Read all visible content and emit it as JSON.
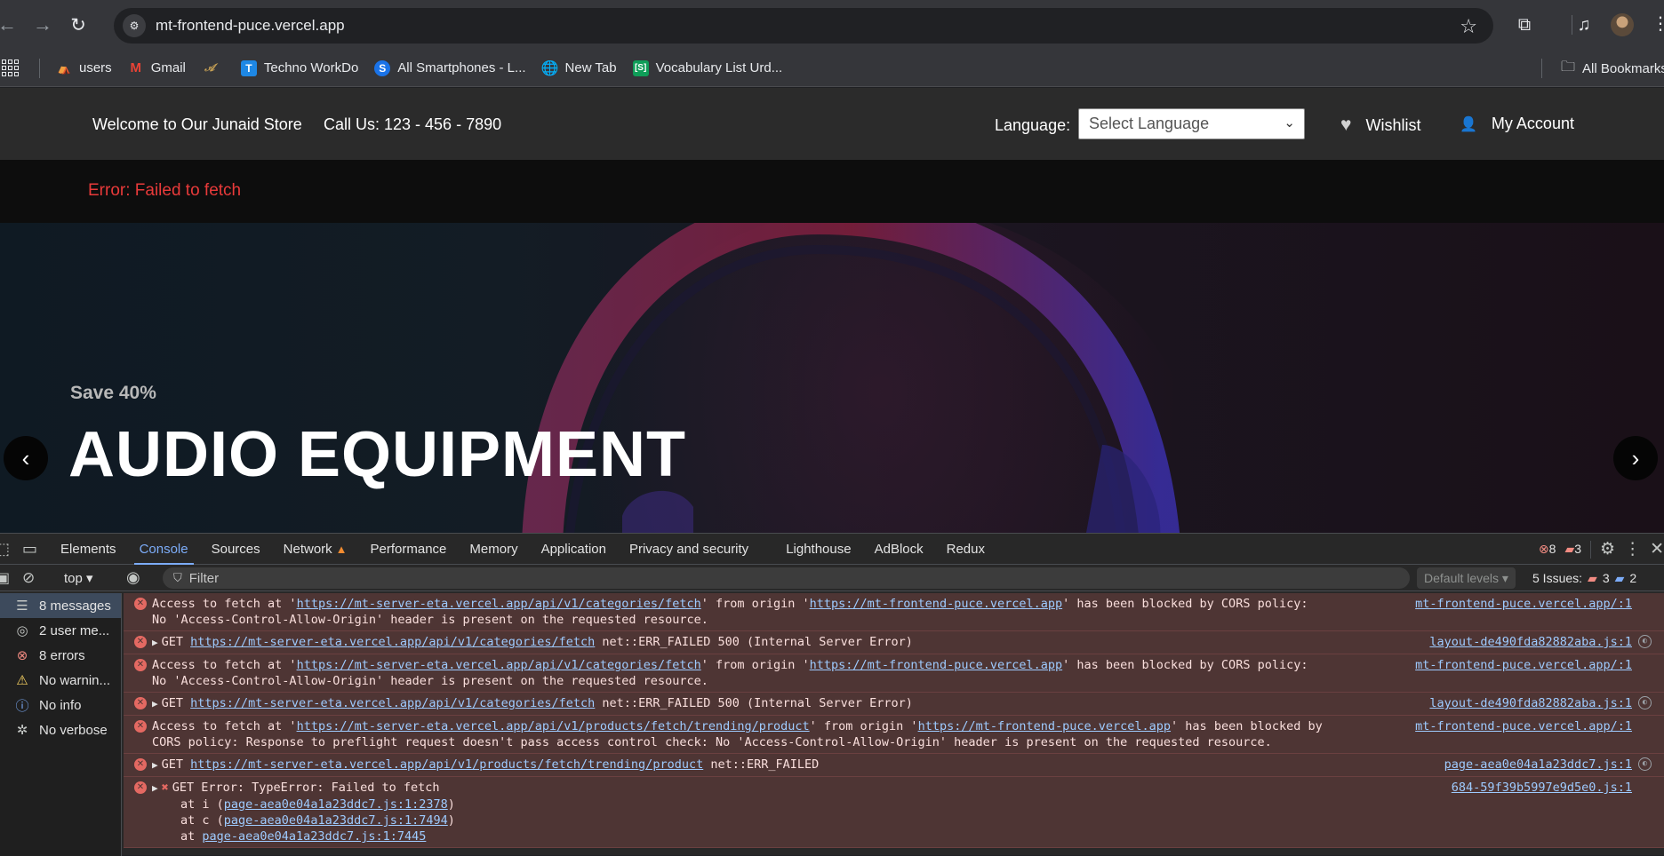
{
  "browser": {
    "url": "mt-frontend-puce.vercel.app",
    "bookmarks": [
      {
        "label": "users",
        "color": "#e6a23c"
      },
      {
        "label": "Gmail",
        "color": "#ea4335"
      },
      {
        "label": "",
        "color": "#c8a255"
      },
      {
        "label": "Techno WorkDo",
        "color": "#1e88e5"
      },
      {
        "label": "All Smartphones - L...",
        "color": "#1a73e8"
      },
      {
        "label": "New Tab",
        "color": "#e8eaed"
      },
      {
        "label": "Vocabulary List Urd...",
        "color": "#0f9d58"
      }
    ],
    "all_bookmarks": "All Bookmarks"
  },
  "page": {
    "welcome": "Welcome to Our Junaid Store",
    "call": "Call Us: 123 - 456 - 7890",
    "language_label": "Language:",
    "language_select": "Select Language",
    "wishlist": "Wishlist",
    "account": "My Account",
    "error": "Error: Failed to fetch",
    "hero": {
      "save": "Save 40%",
      "headline": "AUDIO EQUIPMENT"
    }
  },
  "devtools": {
    "tabs": [
      "Elements",
      "Console",
      "Sources",
      "Network",
      "Performance",
      "Memory",
      "Application",
      "Privacy and security",
      "Lighthouse",
      "AdBlock",
      "Redux"
    ],
    "error_count": "8",
    "issue_count": "3",
    "context": "top",
    "filter_placeholder": "Filter",
    "levels": "Default levels",
    "issues_label": "5 Issues:",
    "issues_err": "3",
    "issues_info": "2",
    "sidebar": [
      {
        "label": "8 messages",
        "icon": "list-icon"
      },
      {
        "label": "2 user me...",
        "icon": "user-icon"
      },
      {
        "label": "8 errors",
        "icon": "error-icon"
      },
      {
        "label": "No warnin...",
        "icon": "warning-icon"
      },
      {
        "label": "No info",
        "icon": "info-icon"
      },
      {
        "label": "No verbose",
        "icon": "bug-icon"
      }
    ],
    "messages": {
      "m1_pre": "Access to fetch at '",
      "m1_url": "https://mt-server-eta.vercel.app/api/v1/categories/fetch",
      "m1_mid": "' from origin '",
      "m1_origin": "https://mt-frontend-puce.vercel.app",
      "m1_post": "' has been blocked by CORS policy: No 'Access-Control-Allow-Origin' header is present on the requested resource.",
      "m1_src": "mt-frontend-puce.vercel.app/:1",
      "m2_pre": "GET ",
      "m2_url": "https://mt-server-eta.vercel.app/api/v1/categories/fetch",
      "m2_post": " net::ERR_FAILED 500 (Internal Server Error)",
      "m2_src": "layout-de490fda82882aba.js:1",
      "m3_pre": "Access to fetch at '",
      "m3_url": "https://mt-server-eta.vercel.app/api/v1/categories/fetch",
      "m3_mid": "' from origin '",
      "m3_origin": "https://mt-frontend-puce.vercel.app",
      "m3_post": "' has been blocked by CORS policy: No 'Access-Control-Allow-Origin' header is present on the requested resource.",
      "m3_src": "mt-frontend-puce.vercel.app/:1",
      "m4_pre": "GET ",
      "m4_url": "https://mt-server-eta.vercel.app/api/v1/categories/fetch",
      "m4_post": " net::ERR_FAILED 500 (Internal Server Error)",
      "m4_src": "layout-de490fda82882aba.js:1",
      "m5_pre": "Access to fetch at '",
      "m5_url": "https://mt-server-eta.vercel.app/api/v1/products/fetch/trending/product",
      "m5_mid": "' from origin '",
      "m5_origin": "https://mt-frontend-puce.vercel.app",
      "m5_post": "' has been blocked by CORS policy: Response to preflight request doesn't pass access control check: No 'Access-Control-Allow-Origin' header is present on the requested resource.",
      "m5_src": "mt-frontend-puce.vercel.app/:1",
      "m6_pre": "GET ",
      "m6_url": "https://mt-server-eta.vercel.app/api/v1/products/fetch/trending/product",
      "m6_post": " net::ERR_FAILED",
      "m6_src": "page-aea0e04a1a23ddc7.js:1",
      "m7_text": "GET Error: TypeError: Failed to fetch",
      "m7_src": "684-59f39b5997e9d5e0.js:1",
      "m7_at1": "page-aea0e04a1a23ddc7.js:1:2378",
      "m7_at2": "page-aea0e04a1a23ddc7.js:1:7494",
      "m7_at3": "page-aea0e04a1a23ddc7.js:1:7445"
    }
  }
}
